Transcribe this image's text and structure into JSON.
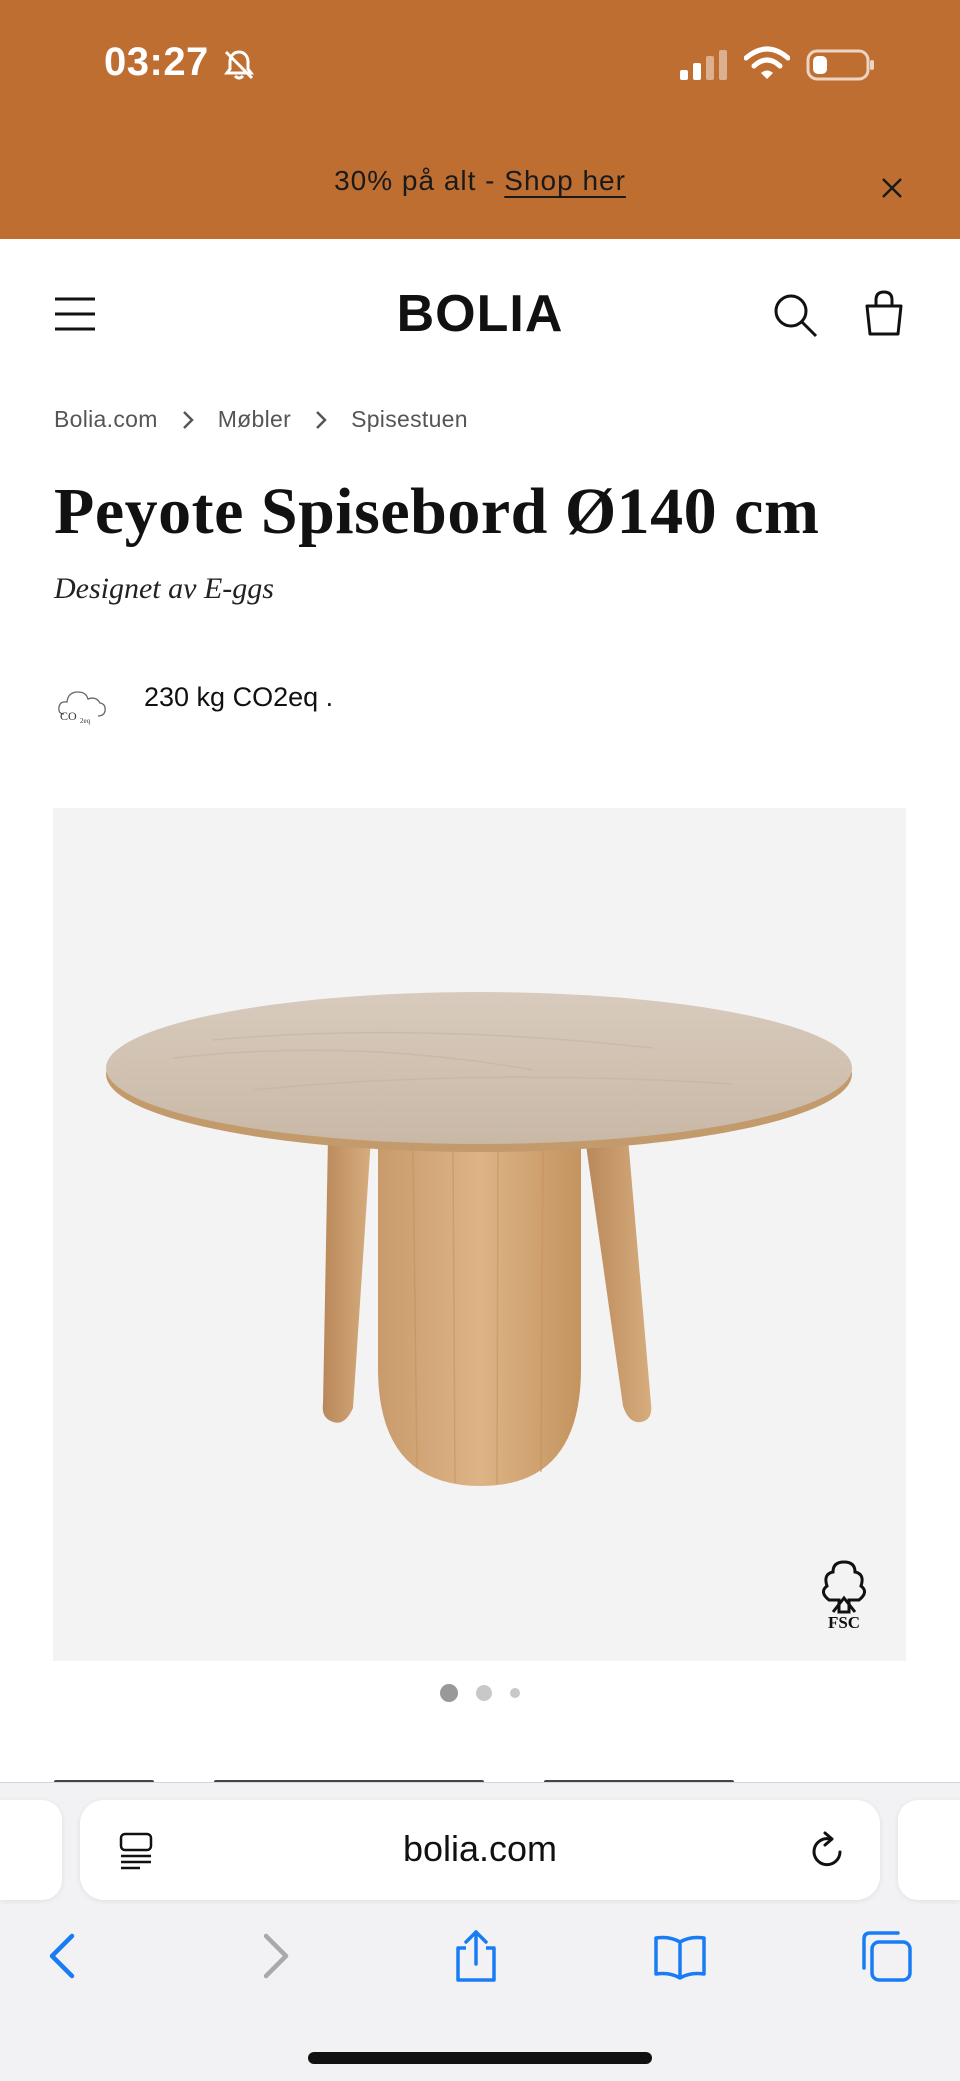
{
  "status_bar": {
    "time": "03:27"
  },
  "promo": {
    "text": "30% på alt - ",
    "link_label": "Shop her"
  },
  "header": {
    "logo": "BOLIA"
  },
  "breadcrumb": [
    "Bolia.com",
    "Møbler",
    "Spisestuen"
  ],
  "product": {
    "title": "Peyote Spisebord Ø140 cm",
    "designer": "Designet av E-ggs",
    "co2_text": "230 kg CO2eq .",
    "co2_icon_label": "CO",
    "co2_icon_sub": "2eq",
    "fsc_label": "FSC"
  },
  "carousel": {
    "total": 3,
    "active_index": 0
  },
  "browser": {
    "url": "bolia.com"
  },
  "icons": {
    "menu": "hamburger-icon",
    "search": "search-icon",
    "bag": "shopping-bag-icon",
    "close": "close-icon",
    "reader": "reader-icon",
    "reload": "reload-icon",
    "back": "back-icon",
    "forward": "forward-icon",
    "share": "share-icon",
    "bookmarks": "bookmarks-icon",
    "tabs": "tabs-icon"
  },
  "colors": {
    "banner": "#bf6e32",
    "ios_blue": "#1a7cf5",
    "image_bg": "#f3f3f3"
  }
}
